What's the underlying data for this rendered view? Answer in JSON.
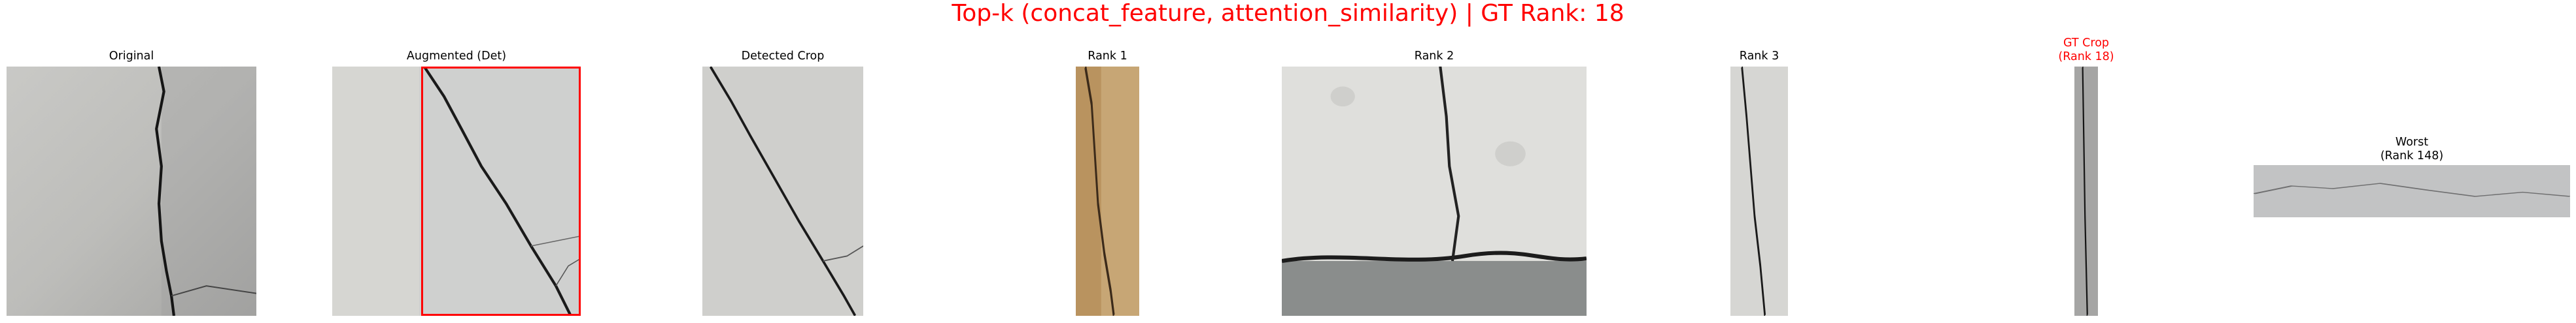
{
  "figure": {
    "title": "Top-k (concat_feature, attention_similarity) | GT Rank: 18",
    "title_color": "#ff0000"
  },
  "panels": {
    "original": {
      "caption": "Original"
    },
    "augmented": {
      "caption": "Augmented (Det)",
      "box_color": "#ff0000"
    },
    "detected": {
      "caption": "Detected Crop"
    },
    "rank1": {
      "caption": "Rank 1"
    },
    "rank2": {
      "caption": "Rank 2"
    },
    "rank3": {
      "caption": "Rank 3"
    },
    "gt": {
      "caption_line1": "GT Crop",
      "caption_line2": "(Rank 18)",
      "caption_color": "#ff0000"
    },
    "worst": {
      "caption_line1": "Worst",
      "caption_line2": "(Rank 148)"
    }
  }
}
